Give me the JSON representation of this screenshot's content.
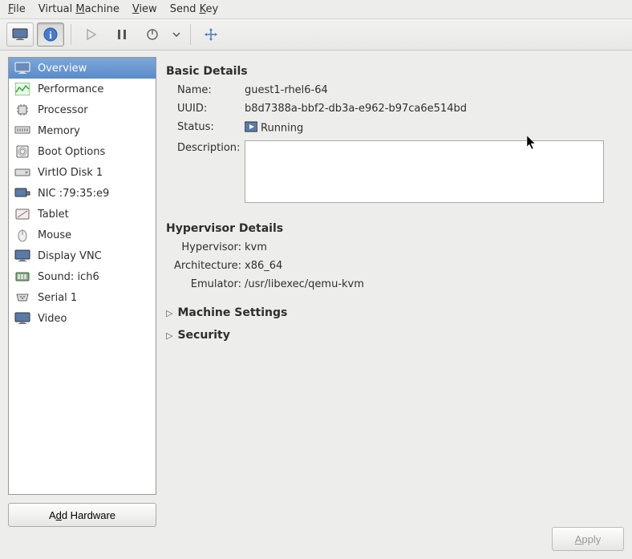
{
  "menu": {
    "file": "File",
    "vm_pre": "Virtual ",
    "vm_u": "M",
    "vm_post": "achine",
    "view_u": "V",
    "view_post": "iew",
    "sendkey_pre": "Send ",
    "sendkey_u": "K",
    "sendkey_post": "ey"
  },
  "sidebar": {
    "items": [
      {
        "label": "Overview"
      },
      {
        "label": "Performance"
      },
      {
        "label": "Processor"
      },
      {
        "label": "Memory"
      },
      {
        "label": "Boot Options"
      },
      {
        "label": "VirtIO Disk 1"
      },
      {
        "label": "NIC :79:35:e9"
      },
      {
        "label": "Tablet"
      },
      {
        "label": "Mouse"
      },
      {
        "label": "Display VNC"
      },
      {
        "label": "Sound: ich6"
      },
      {
        "label": "Serial 1"
      },
      {
        "label": "Video"
      }
    ],
    "add_hw_pre": "A",
    "add_hw_u": "d",
    "add_hw_post": "d Hardware"
  },
  "basic": {
    "title": "Basic Details",
    "name_label": "Name:",
    "name_value": "guest1-rhel6-64",
    "uuid_label": "UUID:",
    "uuid_value": "b8d7388a-bbf2-db3a-e962-b97ca6e514bd",
    "status_label": "Status:",
    "status_value": "Running",
    "desc_label": "Description:",
    "desc_value": ""
  },
  "hypervisor": {
    "title": "Hypervisor Details",
    "hv_label": "Hypervisor:",
    "hv_value": "kvm",
    "arch_label": "Architecture:",
    "arch_value": "x86_64",
    "emu_label": "Emulator:",
    "emu_value": "/usr/libexec/qemu-kvm"
  },
  "expanders": {
    "machine": "Machine Settings",
    "security": "Security"
  },
  "footer": {
    "apply_u": "A",
    "apply_post": "pply"
  }
}
